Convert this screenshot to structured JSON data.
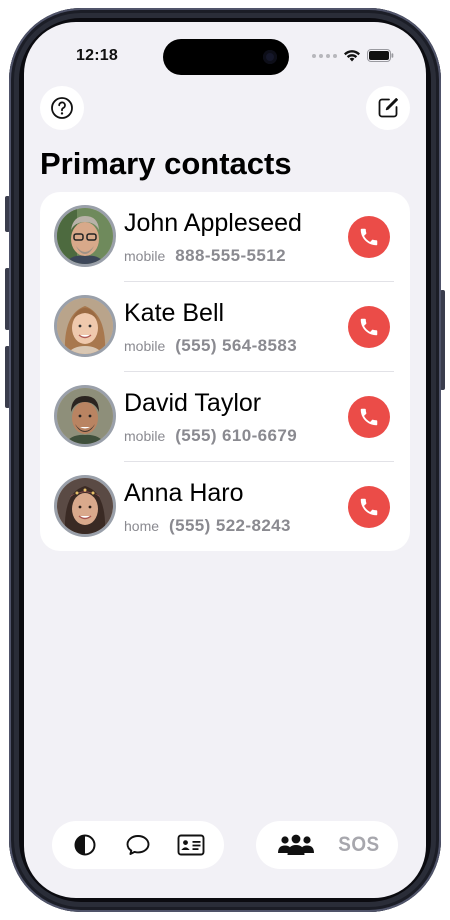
{
  "status_bar": {
    "time": "12:18"
  },
  "header": {
    "help_icon": "question-circle-icon",
    "compose_icon": "compose-icon",
    "title": "Primary contacts"
  },
  "contacts": [
    {
      "name": "John Appleseed",
      "type": "mobile",
      "phone": "888-555-5512"
    },
    {
      "name": "Kate Bell",
      "type": "mobile",
      "phone": "(555) 564-8583"
    },
    {
      "name": "David Taylor",
      "type": "mobile",
      "phone": "(555) 610-6679"
    },
    {
      "name": "Anna Haro",
      "type": "home",
      "phone": "(555) 522-8243"
    }
  ],
  "toolbar": {
    "left_icons": [
      "contrast-icon",
      "chat-bubble-icon",
      "contact-card-icon"
    ],
    "right": {
      "people_icon": "people-icon",
      "sos_label": "SOS"
    }
  },
  "colors": {
    "background": "#f2f1f6",
    "card": "#ffffff",
    "call_button": "#eb4c48",
    "secondary_text": "#8a8a90",
    "inactive_sos": "#a7a7ad"
  }
}
